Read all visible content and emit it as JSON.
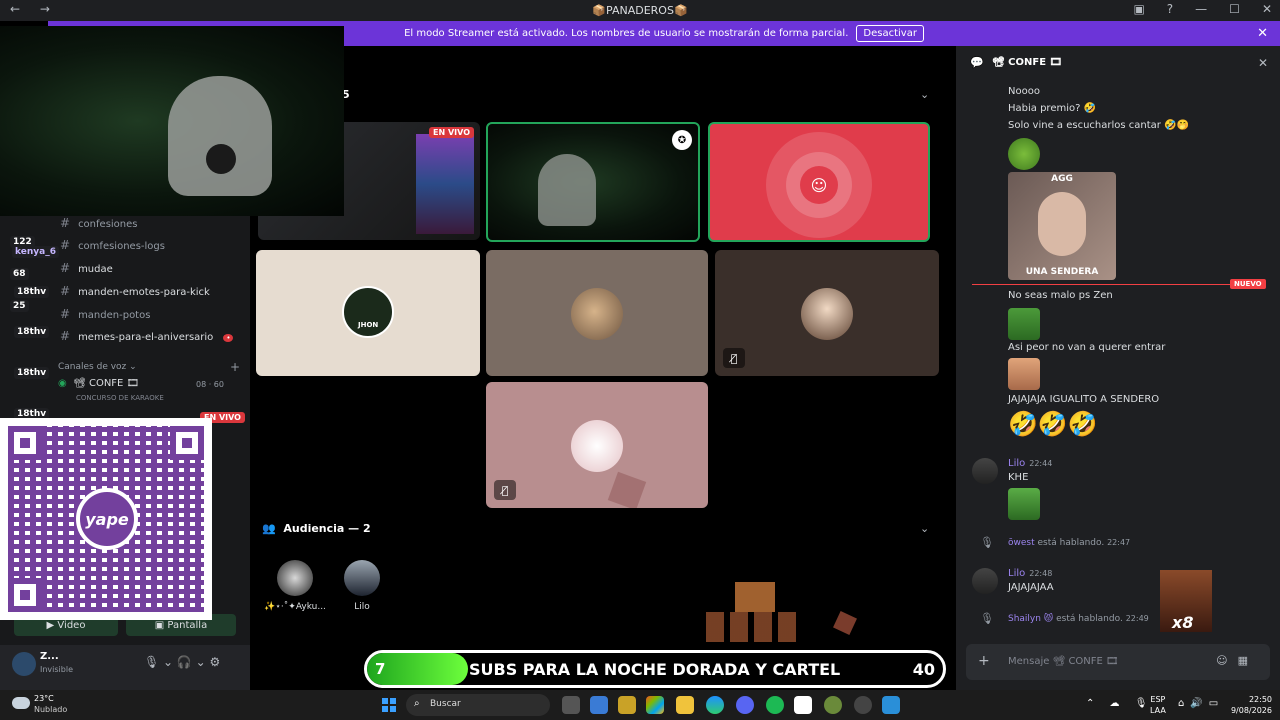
{
  "titlebar": {
    "nav": "← →",
    "title": "📦PANADEROS📦",
    "buttons": [
      "▣",
      "?",
      "—",
      "☐",
      "✕"
    ]
  },
  "banner": {
    "text": "El modo Streamer está activado. Los nombres de usuario se mostrarán de forma parcial.",
    "button": "Desactivar",
    "close": "✕"
  },
  "stage": {
    "header_partial": "5",
    "live_badge": "EN VIVO",
    "audience_label": "Audiencia — 2",
    "audience": [
      {
        "name": "✨⋆·˚✦Ayku..."
      },
      {
        "name": "Lilo"
      }
    ],
    "mute_icon": "🎙̸",
    "tile_avatar_label": "JHON"
  },
  "sidebar": {
    "channels": [
      {
        "name": "confesiones"
      },
      {
        "name": "comfesiones-logs"
      },
      {
        "name": "mudae"
      },
      {
        "name": "manden-emotes-para-kick"
      },
      {
        "name": "manden-potos"
      },
      {
        "name": "memes-para-el-aniversario"
      }
    ],
    "badges": [
      {
        "text": "122"
      },
      {
        "text": "kenya_6"
      },
      {
        "text": "68"
      },
      {
        "text": "18thv"
      },
      {
        "text": "25"
      },
      {
        "text": "18thv"
      },
      {
        "text": "18thv"
      },
      {
        "text": "18thv"
      }
    ],
    "voice_header": "Canales de voz ⌄",
    "voice_plus": "+",
    "voice_channel": "📽 CONFE 🎞",
    "voice_sub": "CONCURSO DE KARAOKE",
    "voice_counts": "08 · 60",
    "voice_live": "EN VIVO",
    "video_button": "Video",
    "screen_button": "Pantalla",
    "user": {
      "name": "Z...",
      "status": "Invisible"
    },
    "controls": "🎙 ⌄ 🎧 ⌄ ⚙"
  },
  "qr": {
    "brand": "yape"
  },
  "chat": {
    "title": "📽 CONFE 🎞",
    "messages": [
      {
        "text": "Noooo"
      },
      {
        "text": "Habia premio? 🤣"
      },
      {
        "text": "Solo vine a escucharlos cantar 🤣🤭"
      },
      {
        "text": "No seas malo ps Zen"
      },
      {
        "text": "Asi peor no van a querer entrar"
      },
      {
        "text": "JAJAJAJA IGUALITO A SENDERO"
      },
      {
        "text": "KHE"
      },
      {
        "text": "JAJAJAJAA"
      }
    ],
    "emojis": "🤣🤣🤣",
    "sticker_top": "AGG",
    "sticker_bottom": "UNA SENDERA",
    "new_tag": "NUEVO",
    "authors": [
      {
        "name": "Lilo",
        "time": "22:44"
      },
      {
        "name": "Lilo",
        "time": "22:48"
      }
    ],
    "speaking": [
      {
        "name": "ōwest",
        "text": "está hablando.",
        "time": "22:47"
      },
      {
        "name": "Shailyn 😾",
        "text": "está hablando.",
        "time": "22:49"
      }
    ],
    "input_placeholder": "Mensaje 📽 CONFE 🎞",
    "overlay_counter": "x8"
  },
  "subs_bar": {
    "current": "7",
    "goal": "40",
    "progress": 0.175,
    "label": "SUBS PARA LA NOCHE DORADA Y CARTEL"
  },
  "taskbar": {
    "weather_temp": "23°C",
    "weather_desc": "Nublado",
    "search_placeholder": "Buscar",
    "lang_line1": "ESP",
    "lang_line2": "LAA",
    "time": "22:50",
    "date": "9/08/2026",
    "tray": "⌃ ☁ 🎙"
  },
  "colors": {
    "banner": "#6c34d8",
    "selected_border": "#23a55a",
    "live_red": "#da373c",
    "discord_red": "#e03c4b",
    "chat_bg": "#1e1f22",
    "author_purple": "#9b84ee"
  }
}
